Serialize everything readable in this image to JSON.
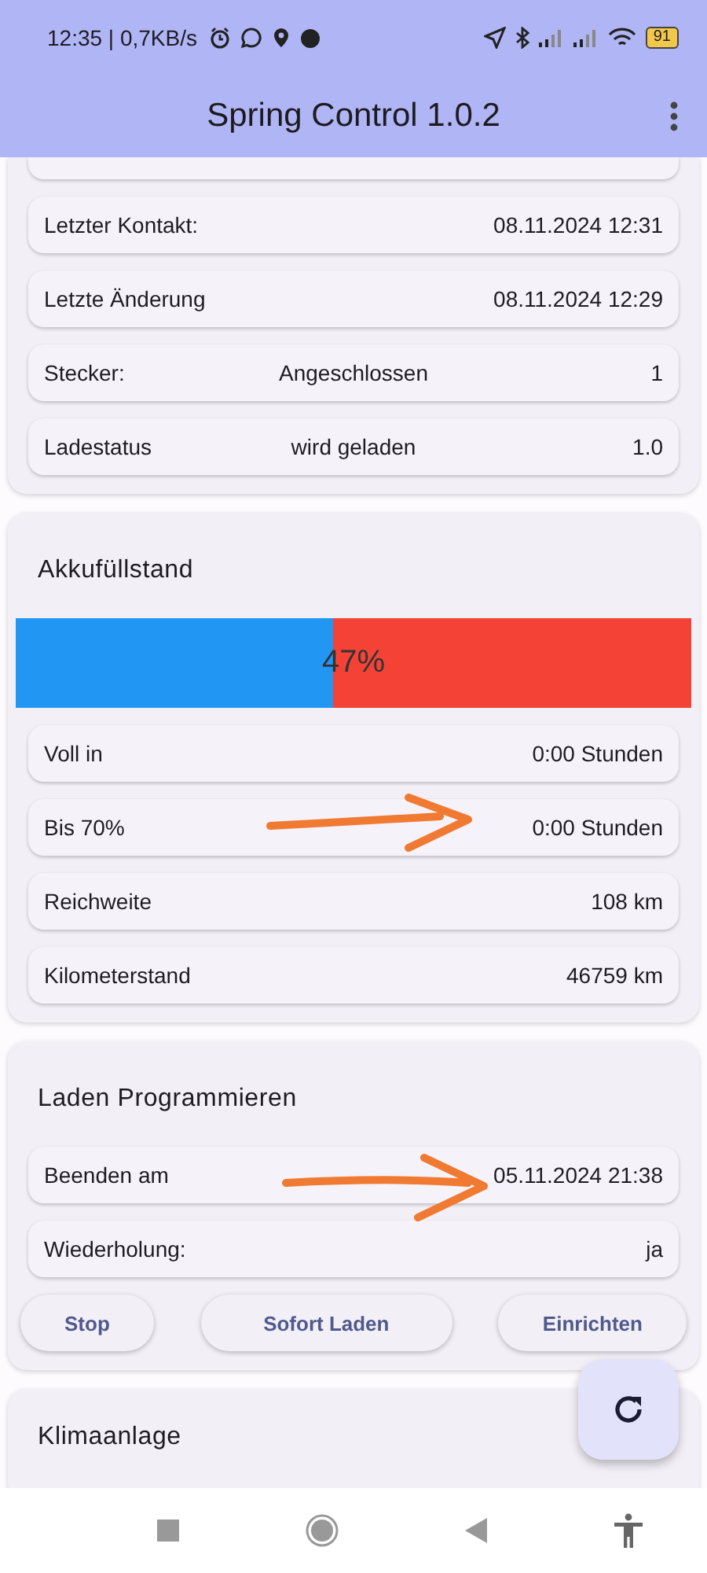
{
  "status_bar": {
    "time": "12:35 | 0,7KB/s",
    "battery": "91"
  },
  "app_bar": {
    "title": "Spring Control 1.0.2"
  },
  "status_card": {
    "rows": [
      {
        "label": "Letzter Kontakt:",
        "value": "08.11.2024 12:31"
      },
      {
        "label": "Letzte Änderung",
        "value": "08.11.2024 12:29"
      },
      {
        "label": "Stecker:",
        "middle": "Angeschlossen",
        "value": "1"
      },
      {
        "label": "Ladestatus",
        "middle": "wird geladen",
        "value": "1.0"
      }
    ]
  },
  "battery_card": {
    "title": "Akkufüllstand",
    "charge": {
      "level": 0.47,
      "reading": "47%"
    },
    "rows": [
      {
        "label": "Voll in",
        "value": "0:00 Stunden"
      },
      {
        "label": "Bis 70%",
        "value": "0:00 Stunden"
      },
      {
        "label": "Reichweite",
        "value": "108 km"
      },
      {
        "label": "Kilometerstand",
        "value": "46759 km"
      }
    ]
  },
  "program_card": {
    "title": "Laden Programmieren",
    "rows": [
      {
        "label": "Beenden am",
        "value": "05.11.2024 21:38"
      },
      {
        "label": "Wiederholung:",
        "value": "ja"
      }
    ],
    "buttons": [
      "Stop",
      "Sofort Laden",
      "Einrichten"
    ]
  },
  "climate_card": {
    "title": "Klimaanlage"
  }
}
